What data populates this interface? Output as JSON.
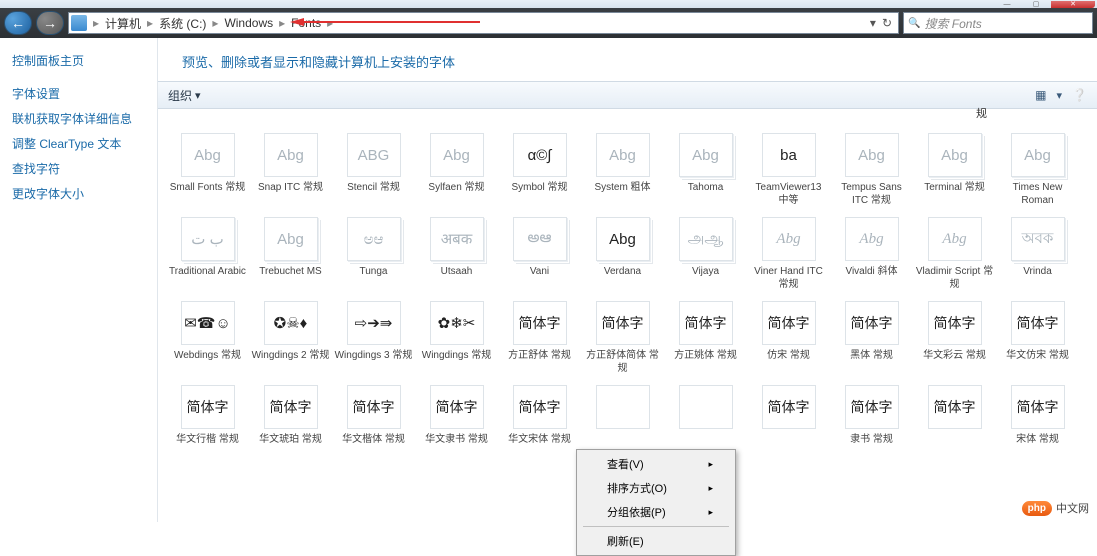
{
  "window": {
    "min": "—",
    "max": "▢",
    "close": "✕"
  },
  "nav": {
    "back": "←",
    "fwd": "→"
  },
  "breadcrumbs": {
    "sep": "▸",
    "items": [
      "计算机",
      "系统 (C:)",
      "Windows",
      "Fonts"
    ],
    "refresh": "↻",
    "dropdown": "▾"
  },
  "search": {
    "placeholder": "搜索 Fonts"
  },
  "sidebar": {
    "title": "控制面板主页",
    "links": [
      "字体设置",
      "联机获取字体详细信息",
      "调整 ClearType 文本",
      "查找字符",
      "更改字体大小"
    ]
  },
  "page": {
    "title": "预览、删除或者显示和隐藏计算机上安装的字体"
  },
  "toolbar": {
    "organize": "组织",
    "arrow": "▾",
    "view": "▦",
    "help": "❔"
  },
  "preview_label": "规",
  "fonts": {
    "row1": [
      {
        "g": "Abg",
        "n": "Small Fonts 常规",
        "cls": "single"
      },
      {
        "g": "Abg",
        "n": "Snap ITC 常规",
        "cls": "single"
      },
      {
        "g": "ABG",
        "n": "Stencil 常规",
        "cls": "single"
      },
      {
        "g": "Abg",
        "n": "Sylfaen 常规",
        "cls": "single"
      },
      {
        "g": "α©∫",
        "n": "Symbol 常规",
        "cls": "single dark"
      },
      {
        "g": "Abg",
        "n": "System 粗体",
        "cls": "single"
      },
      {
        "g": "Abg",
        "n": "Tahoma",
        "cls": ""
      },
      {
        "g": "ba",
        "n": "TeamViewer13 中等",
        "cls": "single dark"
      },
      {
        "g": "Abg",
        "n": "Tempus Sans ITC 常规",
        "cls": "single"
      },
      {
        "g": "Abg",
        "n": "Terminal 常规",
        "cls": ""
      },
      {
        "g": "Abg",
        "n": "Times New Roman",
        "cls": ""
      }
    ],
    "row2": [
      {
        "g": "ب ت",
        "n": "Traditional Arabic",
        "cls": ""
      },
      {
        "g": "Abg",
        "n": "Trebuchet MS",
        "cls": ""
      },
      {
        "g": "ಅಆ",
        "n": "Tunga",
        "cls": ""
      },
      {
        "g": "अबक",
        "n": "Utsaah",
        "cls": ""
      },
      {
        "g": "అఆ",
        "n": "Vani",
        "cls": ""
      },
      {
        "g": "Abg",
        "n": "Verdana",
        "cls": "dark"
      },
      {
        "g": "அஆ",
        "n": "Vijaya",
        "cls": ""
      },
      {
        "g": "Abg",
        "n": "Viner Hand ITC 常规",
        "cls": "single script"
      },
      {
        "g": "Abg",
        "n": "Vivaldi 斜体",
        "cls": "single script"
      },
      {
        "g": "Abg",
        "n": "Vladimir Script 常规",
        "cls": "single script"
      },
      {
        "g": "অবক",
        "n": "Vrinda",
        "cls": ""
      }
    ],
    "row3": [
      {
        "g": "✉☎☺",
        "n": "Webdings 常规",
        "cls": "single dark"
      },
      {
        "g": "✪☠♦",
        "n": "Wingdings 2 常规",
        "cls": "single dark"
      },
      {
        "g": "⇨➔⇛",
        "n": "Wingdings 3 常规",
        "cls": "single dark"
      },
      {
        "g": "✿❄✂",
        "n": "Wingdings 常规",
        "cls": "single dark"
      },
      {
        "g": "简体字",
        "n": "方正舒体 常规",
        "cls": "single dark cjk"
      },
      {
        "g": "简体字",
        "n": "方正舒体简体 常规",
        "cls": "single dark cjk"
      },
      {
        "g": "简体字",
        "n": "方正姚体 常规",
        "cls": "single dark cjk"
      },
      {
        "g": "简体字",
        "n": "仿宋 常规",
        "cls": "single dark cjk"
      },
      {
        "g": "简体字",
        "n": "黑体 常规",
        "cls": "single dark cjk"
      },
      {
        "g": "简体字",
        "n": "华文彩云 常规",
        "cls": "single dark cjk"
      },
      {
        "g": "简体字",
        "n": "华文仿宋 常规",
        "cls": "single dark cjk"
      }
    ],
    "row4": [
      {
        "g": "简体字",
        "n": "华文行楷 常规",
        "cls": "single dark cjk"
      },
      {
        "g": "简体字",
        "n": "华文琥珀 常规",
        "cls": "single dark cjk"
      },
      {
        "g": "简体字",
        "n": "华文楷体 常规",
        "cls": "single dark cjk"
      },
      {
        "g": "简体字",
        "n": "华文隶书 常规",
        "cls": "single dark cjk"
      },
      {
        "g": "简体字",
        "n": "华文宋体 常规",
        "cls": "single dark cjk"
      },
      {
        "g": "",
        "n": "",
        "cls": "single"
      },
      {
        "g": "",
        "n": "",
        "cls": "single"
      },
      {
        "g": "简体字",
        "n": "",
        "cls": "single dark cjk"
      },
      {
        "g": "简体字",
        "n": "隶书 常规",
        "cls": "single dark cjk"
      },
      {
        "g": "简体字",
        "n": "",
        "cls": "single dark cjk"
      },
      {
        "g": "简体字",
        "n": "宋体 常规",
        "cls": "single dark cjk"
      }
    ]
  },
  "context_menu": {
    "items": [
      {
        "label": "查看(V)",
        "sub": true
      },
      {
        "label": "排序方式(O)",
        "sub": true
      },
      {
        "label": "分组依据(P)",
        "sub": true
      },
      {
        "label": "刷新(E)",
        "sub": false
      }
    ],
    "arrow": "▸"
  },
  "watermark": {
    "badge": "php",
    "text": "中文网"
  }
}
